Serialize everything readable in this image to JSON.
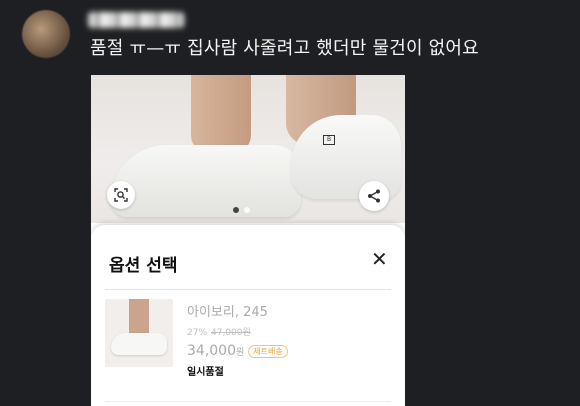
{
  "post": {
    "author_blurred": "",
    "text": "품절 ㅠ—ㅠ 집사람 사줄려고 했더만 물건이 없어요"
  },
  "product_image": {
    "brand_mark": "B",
    "dots": [
      {
        "active": true
      },
      {
        "active": false
      }
    ]
  },
  "option_sheet": {
    "title": "옵션 선택",
    "close_label": "✕",
    "option": {
      "name": "아이보리, 245",
      "discount_percent": "27%",
      "original_price": "47,000원",
      "price": "34,000",
      "price_unit": "원",
      "badge": "제트배송",
      "status": "일시품절"
    }
  }
}
